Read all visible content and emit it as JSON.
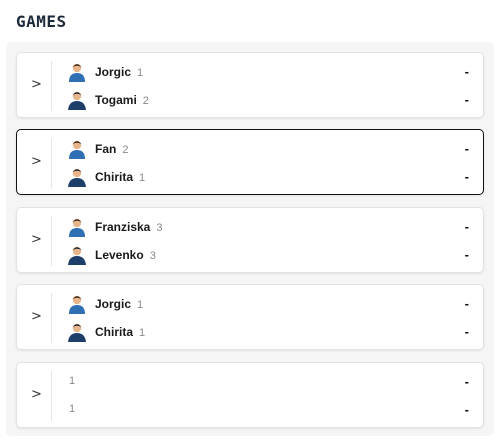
{
  "header": {
    "title": "GAMES"
  },
  "games": [
    {
      "selected": false,
      "expand_icon": ">",
      "p1": {
        "name": "Jorgic",
        "number": "1",
        "score": "-"
      },
      "p2": {
        "name": "Togami",
        "number": "2",
        "score": "-"
      }
    },
    {
      "selected": true,
      "expand_icon": ">",
      "p1": {
        "name": "Fan",
        "number": "2",
        "score": "-"
      },
      "p2": {
        "name": "Chirita",
        "number": "1",
        "score": "-"
      }
    },
    {
      "selected": false,
      "expand_icon": ">",
      "p1": {
        "name": "Franziska",
        "number": "3",
        "score": "-"
      },
      "p2": {
        "name": "Levenko",
        "number": "3",
        "score": "-"
      }
    },
    {
      "selected": false,
      "expand_icon": ">",
      "p1": {
        "name": "Jorgic",
        "number": "1",
        "score": "-"
      },
      "p2": {
        "name": "Chirita",
        "number": "1",
        "score": "-"
      }
    },
    {
      "selected": false,
      "expand_icon": ">",
      "p1": {
        "name": "",
        "number": "1",
        "score": "-"
      },
      "p2": {
        "name": "",
        "number": "1",
        "score": "-"
      }
    }
  ],
  "colors": {
    "avatar_shirt": "#2f6fb3",
    "avatar_hair": "#3a2a1e",
    "avatar_skin": "#e8b48a",
    "selected_border": "#111111"
  },
  "icons": {
    "avatar": "player-avatar-icon",
    "expand": "chevron-right-icon"
  }
}
